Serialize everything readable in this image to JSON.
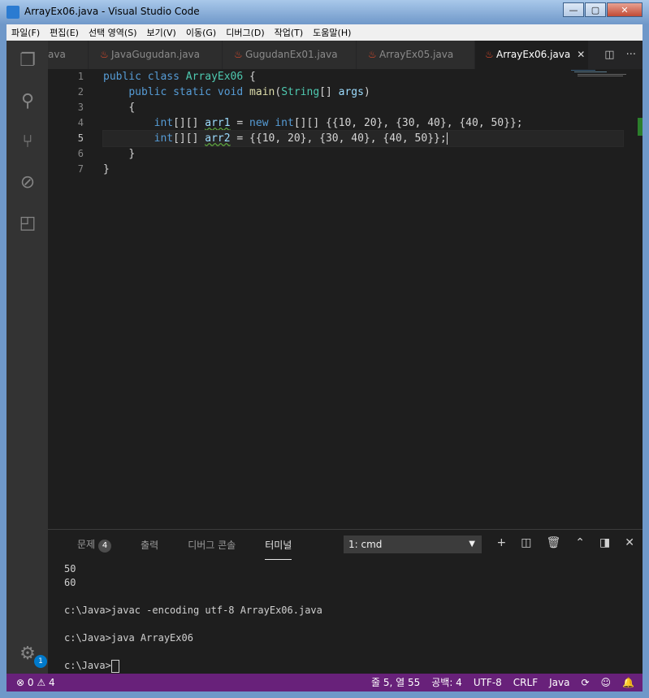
{
  "window": {
    "title": "ArrayEx06.java - Visual Studio Code",
    "min": "—",
    "max": "▢",
    "close": "✕"
  },
  "menu": [
    "파일(F)",
    "편집(E)",
    "선택 영역(S)",
    "보기(V)",
    "이동(G)",
    "디버그(D)",
    "작업(T)",
    "도움말(H)"
  ],
  "tabs": [
    {
      "label": "ava"
    },
    {
      "label": "JavaGugudan.java"
    },
    {
      "label": "GugudanEx01.java"
    },
    {
      "label": "ArrayEx05.java"
    },
    {
      "label": "ArrayEx06.java",
      "close": "✕"
    }
  ],
  "editor": {
    "line_numbers": [
      "1",
      "2",
      "3",
      "4",
      "5",
      "6",
      "7"
    ],
    "code": {
      "l1": {
        "kw1": "public",
        "kw2": "class",
        "name": "ArrayEx06",
        "brace": "{"
      },
      "l2": {
        "kw1": "public",
        "kw2": "static",
        "kw3": "void",
        "fn": "main",
        "type": "String",
        "rest": "[] ",
        "arg": "args",
        "close": ")"
      },
      "l3": "{",
      "l4": {
        "type": "int",
        "dims": "[][] ",
        "var": "arr1",
        "eq": " = ",
        "kw": "new",
        "type2": "int",
        "dims2": "[][] ",
        "init": "{{10, 20}, {30, 40}, {40, 50}};"
      },
      "l5": {
        "type": "int",
        "dims": "[][] ",
        "var": "arr2",
        "init": " = {{10, 20}, {30, 40}, {40, 50}};"
      },
      "l6": "}",
      "l7": "}"
    }
  },
  "panel": {
    "tabs": [
      {
        "label": "문제",
        "badge": "4"
      },
      {
        "label": "출력"
      },
      {
        "label": "디버그 콘솔"
      },
      {
        "label": "터미널"
      }
    ],
    "terminal_select": "1: cmd",
    "terminal_lines": [
      "50",
      "60",
      "",
      "c:\\Java>javac -encoding utf-8 ArrayEx06.java",
      "",
      "c:\\Java>java ArrayEx06",
      "",
      "c:\\Java>"
    ]
  },
  "activity_badge": "1",
  "status": {
    "errors": "0",
    "warnings": "4",
    "position": "줄 5, 열 55",
    "spaces": "공백: 4",
    "encoding": "UTF-8",
    "eol": "CRLF",
    "language": "Java"
  },
  "colors": {
    "status_bar": "#68217a",
    "editor_bg": "#1e1e1e",
    "keyword": "#569cd6",
    "type": "#4ec9b0",
    "number": "#b5cea8"
  }
}
